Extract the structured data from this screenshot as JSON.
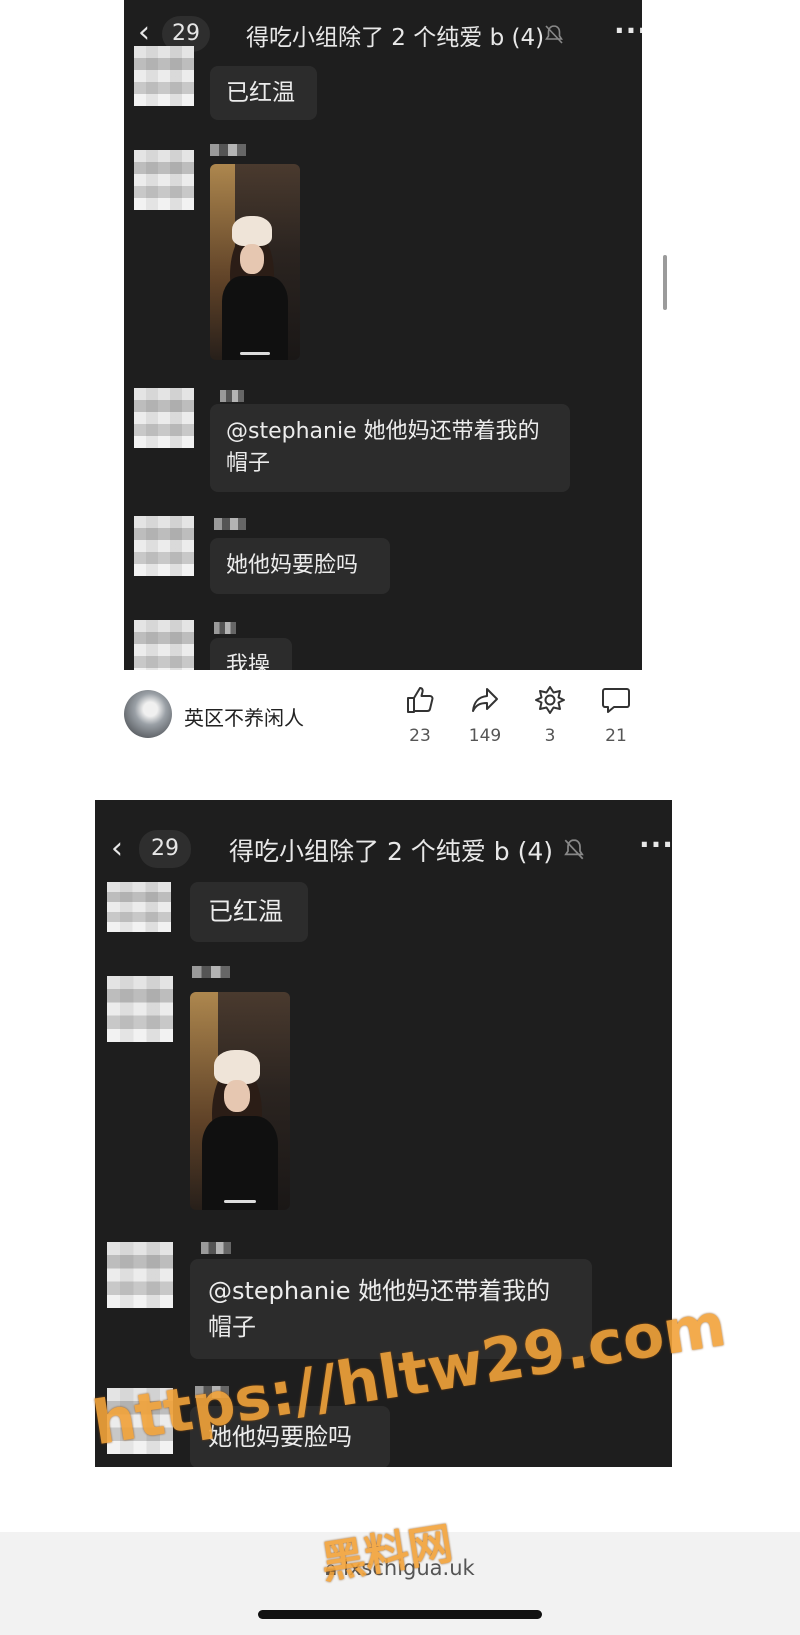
{
  "screenshot1": {
    "header": {
      "back_count": "29",
      "title": "得吃小组除了 2 个纯爱 b (4)"
    },
    "messages": [
      {
        "text": "已红温"
      },
      {
        "image": "selfie-photo"
      },
      {
        "text": "@stephanie 她他妈还带着我的帽子"
      },
      {
        "text": "她他妈要脸吗"
      },
      {
        "text": "我操"
      }
    ]
  },
  "post_bar": {
    "username": "英区不养闲人",
    "actions": [
      {
        "icon": "thumbs-up-icon",
        "count": "23"
      },
      {
        "icon": "share-icon",
        "count": "149"
      },
      {
        "icon": "star-badge-icon",
        "count": "3"
      },
      {
        "icon": "comment-icon",
        "count": "21"
      }
    ]
  },
  "screenshot2": {
    "header": {
      "back_count": "29",
      "title": "得吃小组除了 2 个纯爱 b (4)"
    },
    "messages": [
      {
        "text": "已红温"
      },
      {
        "image": "selfie-photo"
      },
      {
        "text": "@stephanie 她他妈还带着我的帽子"
      },
      {
        "text": "她他妈要脸吗"
      }
    ]
  },
  "browser": {
    "url": "lxschigua.uk"
  },
  "watermark": {
    "line1": "https://hltw29.com",
    "line2": "黑料网"
  },
  "colors": {
    "chat_bg": "#1e1e1e",
    "bubble": "#2c2c2c",
    "watermark": "#f2a33a"
  }
}
